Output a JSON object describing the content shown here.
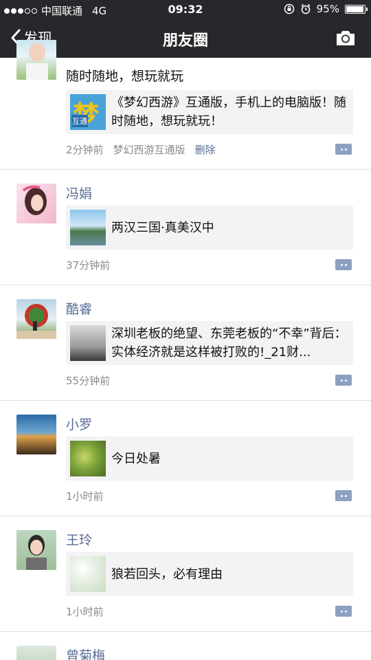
{
  "status_bar": {
    "carrier": "中国联通",
    "network": "4G",
    "time": "09:32",
    "battery": "95%",
    "battery_level": 0.95
  },
  "nav": {
    "back_label": "发现",
    "title": "朋友圈"
  },
  "posts": [
    {
      "text": "随时随地，想玩就玩",
      "link_title": "《梦幻西游》互通版，手机上的电脑版！随时随地，想玩就玩！",
      "time": "2分钟前",
      "source": "梦幻西游互通版",
      "delete_label": "删除",
      "thumb_glyph": "梦",
      "thumb_sub": "互通"
    },
    {
      "author": "冯娟",
      "link_title": "两汉三国·真美汉中",
      "time": "37分钟前"
    },
    {
      "author": "酷睿",
      "link_title": "深圳老板的绝望、东莞老板的“不幸”背后：实体经济就是这样被打败的!_21财...",
      "time": "55分钟前"
    },
    {
      "author": "小罗",
      "link_title": "今日处暑",
      "time": "1小时前"
    },
    {
      "author": "王玲",
      "link_title": "狼若回头，必有理由",
      "time": "1小时前"
    },
    {
      "author": "曾菊梅"
    }
  ],
  "colors": {
    "bar_bg": "#26282b",
    "link_blue": "#576b95",
    "card_bg": "#f3f3f5"
  }
}
